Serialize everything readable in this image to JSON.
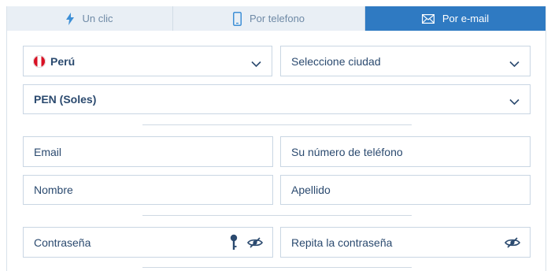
{
  "tabs": [
    {
      "label": "Un clic",
      "icon": "lightning-icon"
    },
    {
      "label": "Por telefono",
      "icon": "phone-icon"
    },
    {
      "label": "Por e-mail",
      "icon": "envelope-icon",
      "active": true
    }
  ],
  "form": {
    "country": "Perú",
    "city_placeholder": "Seleccione ciudad",
    "currency": "PEN (Soles)",
    "email_placeholder": "Email",
    "phone_placeholder": "Su número de teléfono",
    "first_name_placeholder": "Nombre",
    "last_name_placeholder": "Apellido",
    "password_placeholder": "Contraseña",
    "repeat_password_placeholder": "Repita la contraseña"
  },
  "colors": {
    "accent": "#2f7ac2",
    "tab_inactive_bg": "#e9eff5",
    "text": "#2b4a6f",
    "border": "#c9d6e3"
  }
}
